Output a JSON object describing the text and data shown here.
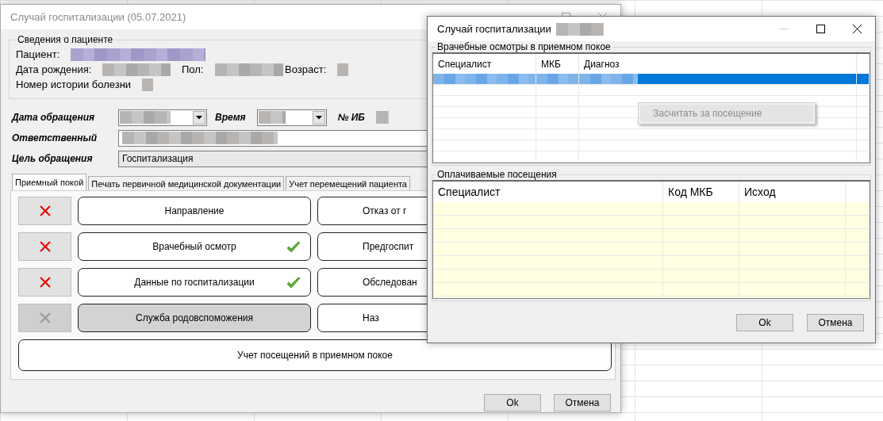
{
  "main_window": {
    "title": "Случай госпитализации (05.07.2021)",
    "active": false,
    "patient_group": {
      "title": "Сведения о пациенте",
      "rows": [
        [
          {
            "label": "Пациент:",
            "kind": "link"
          }
        ],
        [
          {
            "label": "Дата рождения:",
            "kind": "text"
          },
          {
            "label": "Пол:",
            "kind": "text"
          },
          {
            "label": "Возраст:",
            "kind": "short"
          }
        ],
        [
          {
            "label": "Номер истории болезни",
            "kind": "short"
          }
        ]
      ]
    },
    "request_date": {
      "label": "Дата обращения"
    },
    "time": {
      "label": "Время"
    },
    "ib_number": {
      "label": "№ ИБ"
    },
    "responsible": {
      "label": "Ответственный"
    },
    "purpose": {
      "label": "Цель обращения",
      "value": "Госпитализация"
    },
    "tabs": [
      {
        "label": "Приемный покой",
        "selected": true
      },
      {
        "label": "Печать первичной медицинской документации",
        "selected": false
      },
      {
        "label": "Учет перемещений пациента",
        "selected": false
      }
    ],
    "steps": [
      {
        "label": "Направление",
        "done": false,
        "disabled": false,
        "side_label": "Отказ от г"
      },
      {
        "label": "Врачебный осмотр",
        "done": true,
        "disabled": false,
        "side_label": "Предгоспит"
      },
      {
        "label": "Данные по госпитализации",
        "done": true,
        "disabled": false,
        "side_label": "Обследован"
      },
      {
        "label": "Служба родовспоможения",
        "done": false,
        "disabled": true,
        "side_label": "Наз"
      }
    ],
    "wide_button": "Учет посещений в приемном покое",
    "buttons": [
      "Ok",
      "Отмена"
    ]
  },
  "dialog": {
    "title": "Случай госпитализации",
    "active": true,
    "exams": {
      "title": "Врачебные осмотры в приемном покое",
      "columns": [
        "Специалист",
        "МКБ",
        "Диагноз"
      ],
      "rows": [
        {
          "selected": true
        }
      ]
    },
    "context_menu": [
      {
        "label": "Засчитать за посещение",
        "disabled": true
      }
    ],
    "visits": {
      "title": "Оплачиваемые посещения",
      "columns": [
        "Специалист",
        "Код МКБ",
        "Исход"
      ]
    },
    "buttons": [
      "Ok",
      "Отмена"
    ]
  }
}
